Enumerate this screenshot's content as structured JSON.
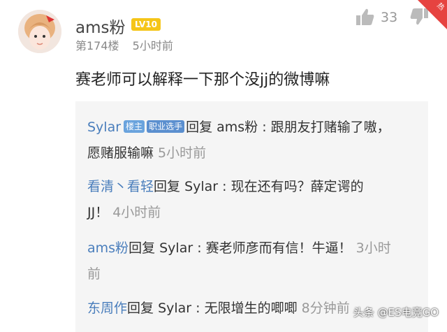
{
  "post": {
    "username": "ams粉",
    "level": "LV10",
    "floor": "第174楼",
    "time": "5小时前",
    "like_count": "33",
    "content": "赛老师可以解释一下那个没jj的微博嘛",
    "corner_label": "热"
  },
  "replies": [
    {
      "author": "Sylar",
      "tags": [
        "楼主",
        "职业选手"
      ],
      "reply_word": "回复",
      "target": "ams粉",
      "text": " : 跟朋友打赌输了嗷，",
      "text2": "愿赌服输嘛",
      "time": "5小时前"
    },
    {
      "author": "看清丶看轻",
      "reply_word": "回复",
      "target": "Sylar",
      "text": " : 现在还有吗？薛定谔的",
      "text2": "JJ！",
      "time": "4小时前"
    },
    {
      "author": "ams粉",
      "reply_word": "回复",
      "target": "Sylar",
      "text": " : 赛老师彦而有信！牛逼！",
      "time": "3小时",
      "time2": "前"
    },
    {
      "author": "东周作",
      "reply_word": "回复",
      "target": "Sylar",
      "text": " : 无限增生的唧唧",
      "time": "8分钟前"
    }
  ],
  "watermark": "头条 @ES电竞GO",
  "colors": {
    "link": "#4a7ebc",
    "level_badge": "#f5c518",
    "tag": "#6aa3dd"
  },
  "icons": {
    "like": "thumbs-up-icon",
    "dislike": "thumbs-down-icon"
  }
}
